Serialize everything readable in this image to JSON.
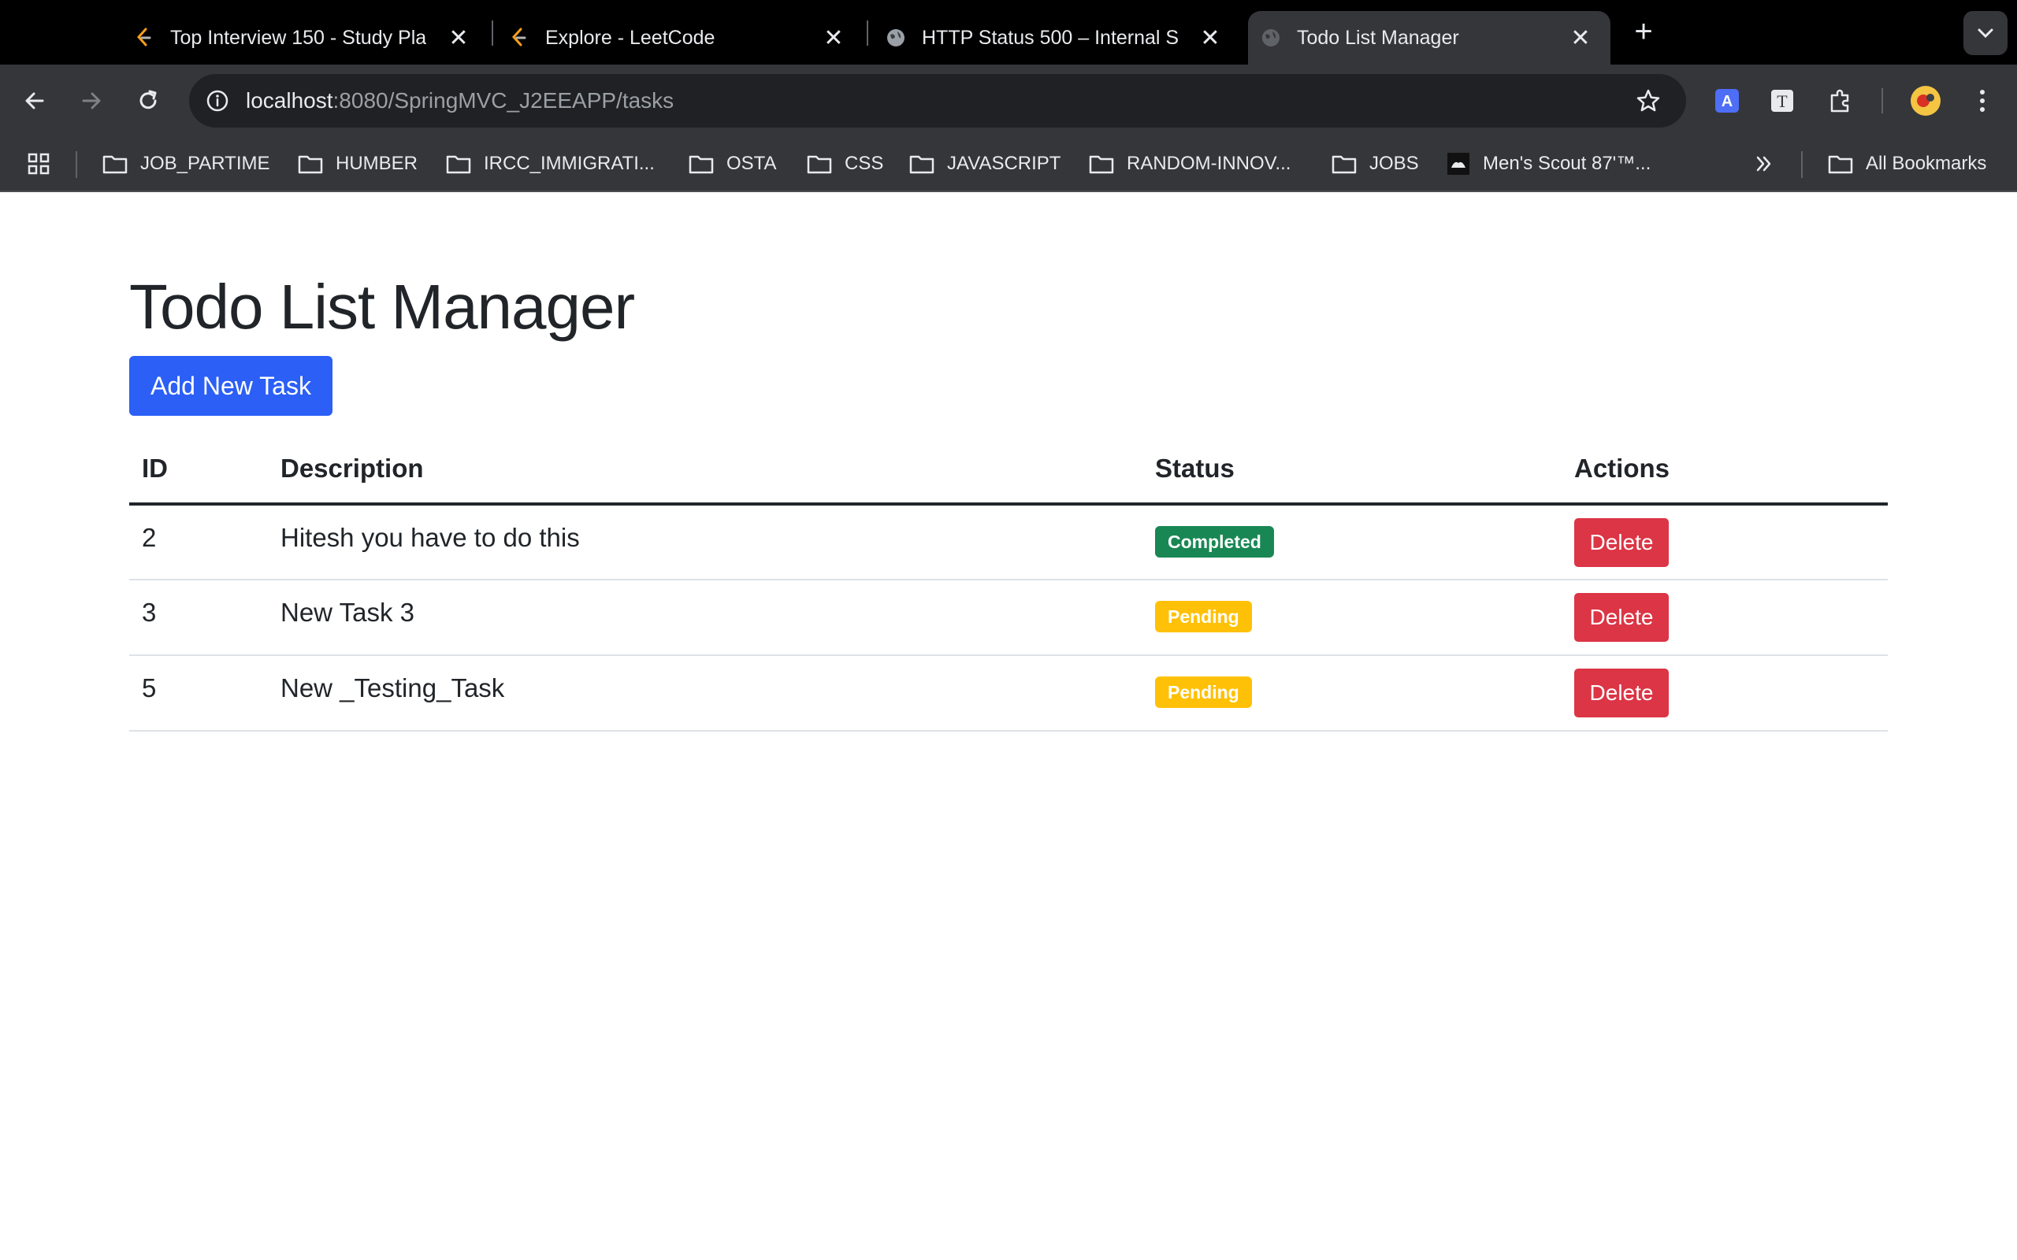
{
  "browser": {
    "tabs": [
      {
        "title": "Top Interview 150 - Study Pla",
        "favicon": "leetcode-icon",
        "active": false
      },
      {
        "title": "Explore - LeetCode",
        "favicon": "leetcode-icon",
        "active": false
      },
      {
        "title": "HTTP Status 500 – Internal S",
        "favicon": "globe-icon",
        "active": false
      },
      {
        "title": "Todo List Manager",
        "favicon": "globe-icon",
        "active": true
      }
    ],
    "address": {
      "host": "localhost",
      "path": ":8080/SpringMVC_J2EEAPP/tasks"
    },
    "bookmarks": [
      {
        "label": "JOB_PARTIME",
        "icon": "folder-icon"
      },
      {
        "label": "HUMBER",
        "icon": "folder-icon"
      },
      {
        "label": "IRCC_IMMIGRATI...",
        "icon": "folder-icon"
      },
      {
        "label": "OSTA",
        "icon": "folder-icon"
      },
      {
        "label": "CSS",
        "icon": "folder-icon"
      },
      {
        "label": "JAVASCRIPT",
        "icon": "folder-icon"
      },
      {
        "label": "RANDOM-INNOV...",
        "icon": "folder-icon"
      },
      {
        "label": "JOBS",
        "icon": "folder-icon"
      },
      {
        "label": "Men's Scout 87'™...",
        "icon": "site-icon"
      }
    ],
    "all_bookmarks": "All Bookmarks"
  },
  "page": {
    "title": "Todo List Manager",
    "add_button": "Add New Task",
    "table": {
      "headers": {
        "id": "ID",
        "description": "Description",
        "status": "Status",
        "actions": "Actions"
      },
      "rows": [
        {
          "id": "2",
          "description": "Hitesh you have to do this",
          "status": "Completed",
          "action": "Delete"
        },
        {
          "id": "3",
          "description": "New Task 3",
          "status": "Pending",
          "action": "Delete"
        },
        {
          "id": "5",
          "description": "New _Testing_Task",
          "status": "Pending",
          "action": "Delete"
        }
      ]
    }
  },
  "colors": {
    "primary": "#2b5ff5",
    "danger": "#dc3545",
    "success": "#198754",
    "warning": "#ffc107"
  }
}
